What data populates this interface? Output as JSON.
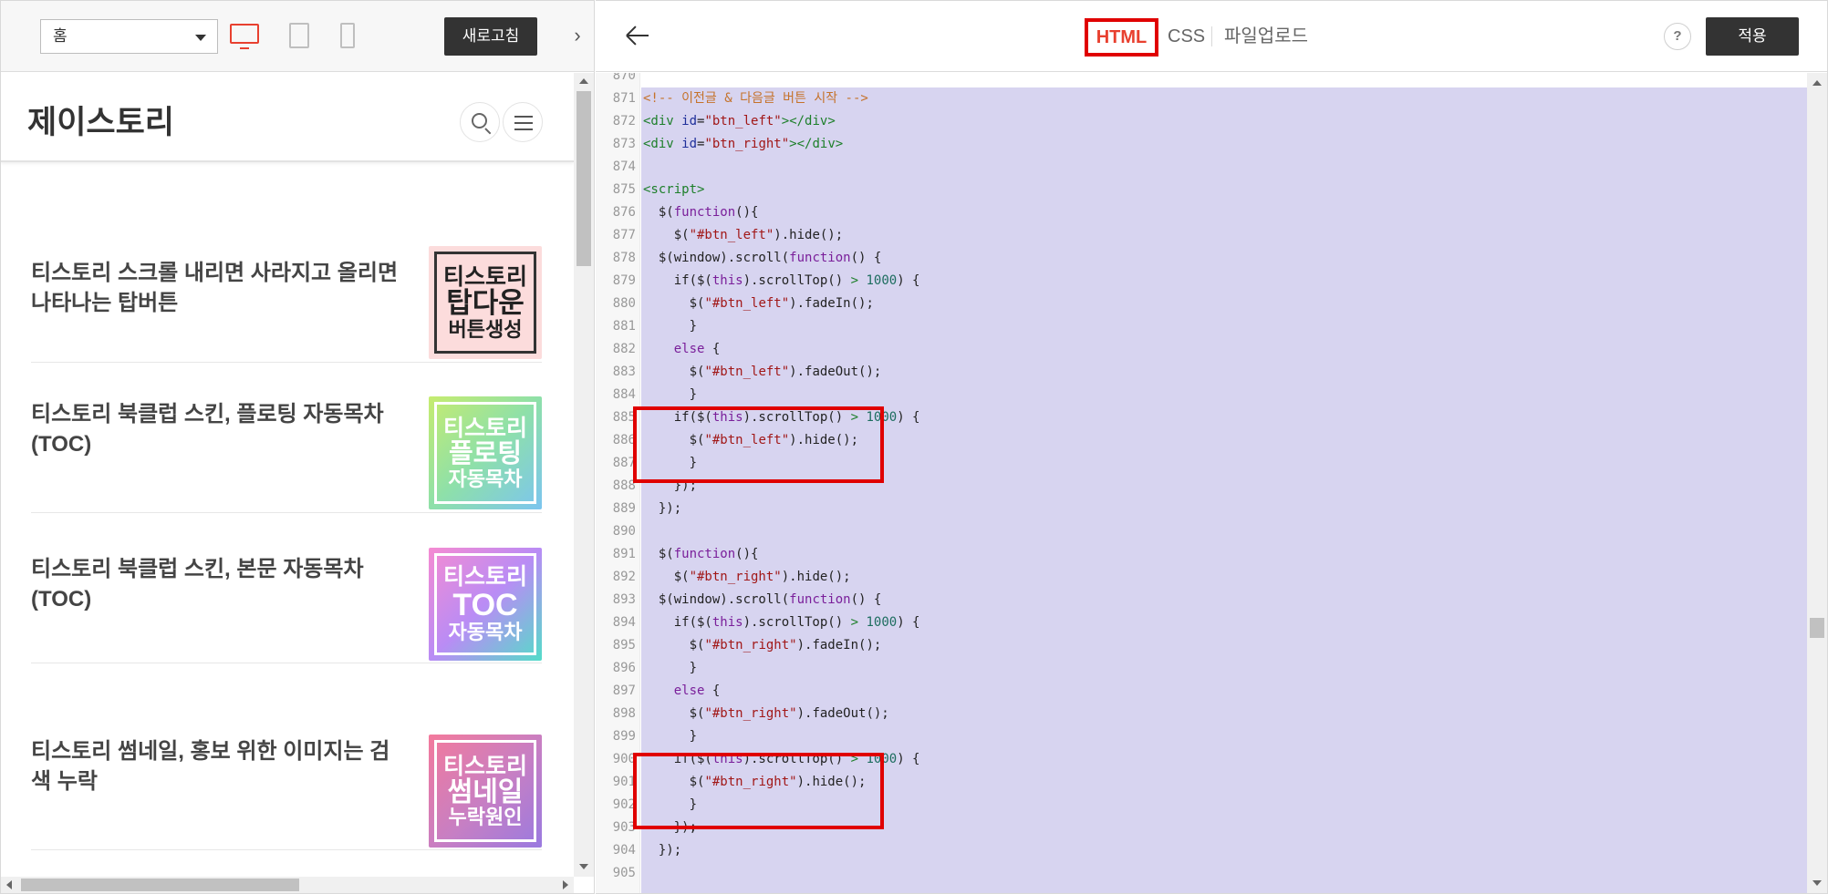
{
  "left_toolbar": {
    "page_select_value": "홈",
    "refresh_label": "새로고침",
    "collapse_glyph": "›"
  },
  "blog": {
    "title": "제이스토리",
    "posts": [
      {
        "title": "티스토리 스크롤 내리면 사라지고 올리면 나타나는 탑버튼",
        "thumb_lines": [
          "티스토리",
          "탑다운",
          "버튼생성"
        ]
      },
      {
        "title": "티스토리 북클럽 스킨, 플로팅 자동목차 (TOC)",
        "thumb_lines": [
          "티스토리",
          "플로팅",
          "자동목차"
        ]
      },
      {
        "title": "티스토리 북클럽 스킨, 본문 자동목차 (TOC)",
        "thumb_lines": [
          "티스토리",
          "TOC",
          "자동목차"
        ]
      },
      {
        "title": "티스토리 썸네일, 홍보 위한 이미지는 검색 누락",
        "thumb_lines": [
          "티스토리",
          "썸네일",
          "누락원인"
        ]
      }
    ]
  },
  "right_toolbar": {
    "tab_html": "HTML",
    "tab_css": "CSS",
    "tab_upload": "파일업로드",
    "help": "?",
    "apply_label": "적용"
  },
  "editor": {
    "partial_top_line": "870",
    "lines": [
      {
        "n": "871",
        "text": "<!-- 이전글 & 다음글 버튼 시작 -->"
      },
      {
        "n": "872",
        "text": "<div id=\"btn_left\"></div>"
      },
      {
        "n": "873",
        "text": "<div id=\"btn_right\"></div>"
      },
      {
        "n": "874",
        "text": ""
      },
      {
        "n": "875",
        "text": "<script>"
      },
      {
        "n": "876",
        "text": "  $(function(){"
      },
      {
        "n": "877",
        "text": "    $(\"#btn_left\").hide();"
      },
      {
        "n": "878",
        "text": "  $(window).scroll(function() {"
      },
      {
        "n": "879",
        "text": "    if($(this).scrollTop() > 1000) {"
      },
      {
        "n": "880",
        "text": "      $(\"#btn_left\").fadeIn();"
      },
      {
        "n": "881",
        "text": "      }"
      },
      {
        "n": "882",
        "text": "    else {"
      },
      {
        "n": "883",
        "text": "      $(\"#btn_left\").fadeOut();"
      },
      {
        "n": "884",
        "text": "      }"
      },
      {
        "n": "885",
        "text": "    if($(this).scrollTop() > 1000) {"
      },
      {
        "n": "886",
        "text": "      $(\"#btn_left\").hide();"
      },
      {
        "n": "887",
        "text": "      }"
      },
      {
        "n": "888",
        "text": "    });"
      },
      {
        "n": "889",
        "text": "  });"
      },
      {
        "n": "890",
        "text": ""
      },
      {
        "n": "891",
        "text": "  $(function(){"
      },
      {
        "n": "892",
        "text": "    $(\"#btn_right\").hide();"
      },
      {
        "n": "893",
        "text": "  $(window).scroll(function() {"
      },
      {
        "n": "894",
        "text": "    if($(this).scrollTop() > 1000) {"
      },
      {
        "n": "895",
        "text": "      $(\"#btn_right\").fadeIn();"
      },
      {
        "n": "896",
        "text": "      }"
      },
      {
        "n": "897",
        "text": "    else {"
      },
      {
        "n": "898",
        "text": "      $(\"#btn_right\").fadeOut();"
      },
      {
        "n": "899",
        "text": "      }"
      },
      {
        "n": "900",
        "text": "    if($(this).scrollTop() > 1000) {"
      },
      {
        "n": "901",
        "text": "      $(\"#btn_right\").hide();"
      },
      {
        "n": "902",
        "text": "      }"
      },
      {
        "n": "903",
        "text": "    });"
      },
      {
        "n": "904",
        "text": "  });"
      },
      {
        "n": "905",
        "text": ""
      }
    ],
    "highlighted_ranges": [
      [
        "885",
        "887"
      ],
      [
        "900",
        "902"
      ]
    ]
  },
  "colors": {
    "accent_red": "#e8402f",
    "highlight_box": "#e00000",
    "code_selection_bg": "#d7d4f0",
    "dark_button": "#333333"
  }
}
